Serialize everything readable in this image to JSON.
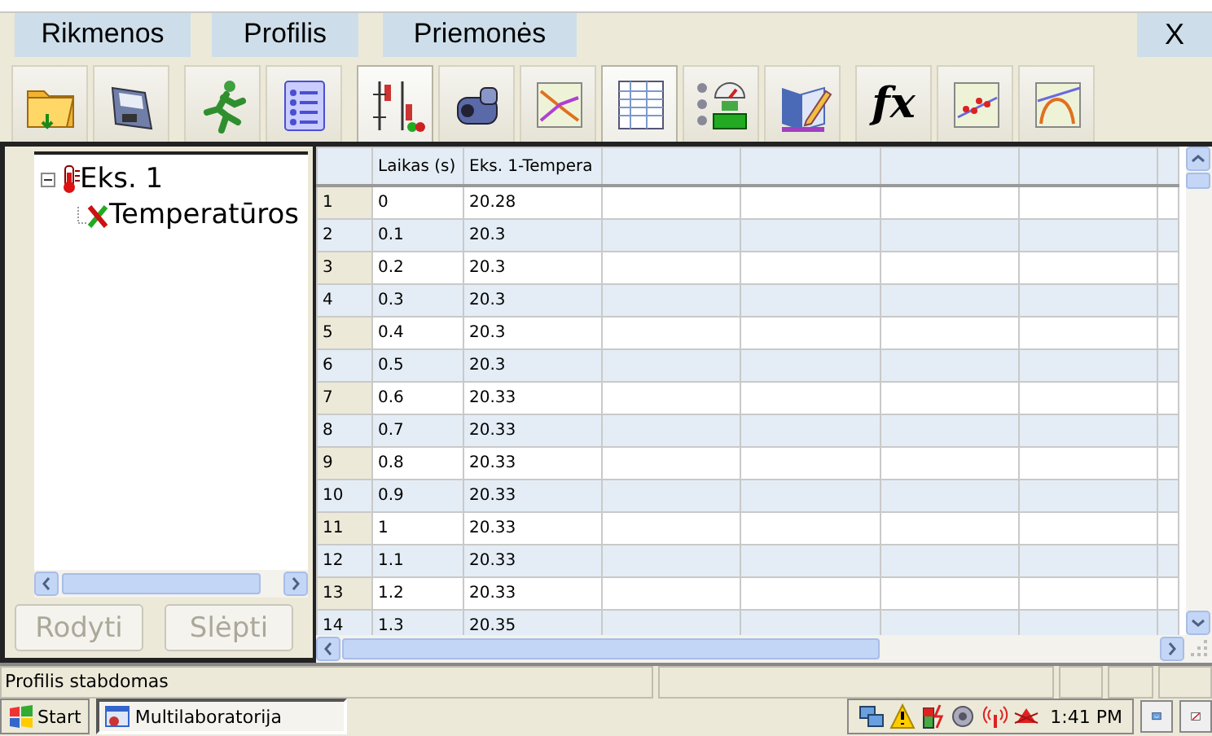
{
  "menu": [
    {
      "label": "Rikmenos"
    },
    {
      "label": "Profilis"
    },
    {
      "label": "Priemonės"
    }
  ],
  "close_button": "X",
  "toolbar": [
    {
      "kind": "open",
      "selected": false
    },
    {
      "kind": "save",
      "selected": false
    },
    {
      "kind": "run",
      "selected": false
    },
    {
      "kind": "list",
      "selected": false
    },
    {
      "kind": "probes",
      "selected": true
    },
    {
      "kind": "camera",
      "selected": false
    },
    {
      "kind": "graph",
      "selected": false
    },
    {
      "kind": "table",
      "selected": true
    },
    {
      "kind": "meter",
      "selected": false
    },
    {
      "kind": "notes",
      "selected": false
    },
    {
      "kind": "function",
      "label": "fx",
      "selected": false
    },
    {
      "kind": "scatter",
      "selected": false
    },
    {
      "kind": "curve",
      "selected": false
    }
  ],
  "tree": [
    {
      "label": "Eks. 1",
      "expanded": true,
      "children": [
        {
          "label": "Temperatūros"
        }
      ]
    }
  ],
  "tree_buttons": [
    {
      "label": "Rodyti",
      "disabled": true
    },
    {
      "label": "Slėpti",
      "disabled": true
    }
  ],
  "table": {
    "columns": [
      "",
      "Laikas (s)",
      "Eks. 1-Tempera"
    ],
    "rows": [
      [
        "1",
        "0",
        "20.28"
      ],
      [
        "2",
        "0.1",
        "20.3"
      ],
      [
        "3",
        "0.2",
        "20.3"
      ],
      [
        "4",
        "0.3",
        "20.3"
      ],
      [
        "5",
        "0.4",
        "20.3"
      ],
      [
        "6",
        "0.5",
        "20.3"
      ],
      [
        "7",
        "0.6",
        "20.33"
      ],
      [
        "8",
        "0.7",
        "20.33"
      ],
      [
        "9",
        "0.8",
        "20.33"
      ],
      [
        "10",
        "0.9",
        "20.33"
      ],
      [
        "11",
        "1",
        "20.33"
      ],
      [
        "12",
        "1.1",
        "20.33"
      ],
      [
        "13",
        "1.2",
        "20.33"
      ],
      [
        "14",
        "1.3",
        "20.35"
      ]
    ]
  },
  "status_bar": {
    "text": "Profilis stabdomas"
  },
  "taskbar": {
    "start": "Start",
    "tasks": [
      {
        "label": "Multilaboratorija"
      }
    ],
    "clock": "1:41 PM"
  }
}
